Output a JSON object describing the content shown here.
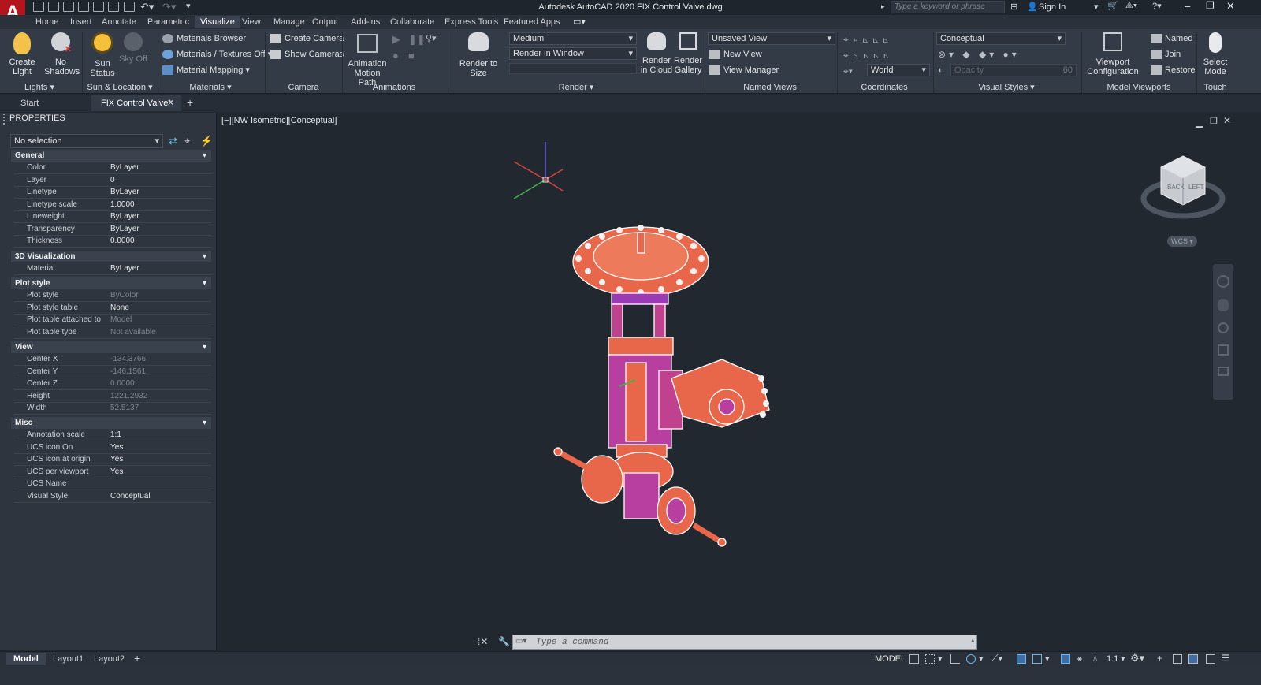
{
  "app": {
    "title": "Autodesk AutoCAD 2020   FIX Control Valve.dwg",
    "logo": "A",
    "search_placeholder": "Type a keyword or phrase",
    "signin": "Sign In"
  },
  "ribbon_tabs": [
    "Home",
    "Insert",
    "Annotate",
    "Parametric",
    "Visualize",
    "View",
    "Manage",
    "Output",
    "Add-ins",
    "Collaborate",
    "Express Tools",
    "Featured Apps"
  ],
  "active_tab": "Visualize",
  "panels": {
    "lights": {
      "title": "Lights",
      "create_light": "Create Light",
      "no_shadows": "No Shadows"
    },
    "sun": {
      "title": "Sun & Location",
      "sun_status": "Sun Status",
      "sky_off": "Sky Off"
    },
    "materials": {
      "title": "Materials",
      "browser": "Materials Browser",
      "textures": "Materials / Textures Off",
      "mapping": "Material Mapping"
    },
    "camera": {
      "title": "Camera",
      "create": "Create Camera",
      "show": "Show  Cameras"
    },
    "animations": {
      "title": "Animations",
      "motion_path": "Animation Motion Path"
    },
    "render": {
      "title": "Render",
      "render_to_size": "Render to Size",
      "quality": "Medium",
      "target": "Render in Window",
      "cloud": "Render in Cloud",
      "gallery": "Render Gallery"
    },
    "named_views": {
      "title": "Named Views",
      "current": "Unsaved View",
      "new_view": "New View",
      "manager": "View Manager"
    },
    "coordinates": {
      "title": "Coordinates",
      "ucs": "World"
    },
    "visual_styles": {
      "title": "Visual Styles",
      "style": "Conceptual",
      "opacity_label": "Opacity",
      "opacity_value": "60"
    },
    "model_viewports": {
      "title": "Model Viewports",
      "config": "Viewport Configuration",
      "named": "Named",
      "join": "Join",
      "restore": "Restore"
    },
    "touch": {
      "title": "Touch",
      "select_mode": "Select Mode"
    }
  },
  "doc_tabs": [
    "Start",
    "FIX Control Valve*"
  ],
  "properties": {
    "title": "PROPERTIES",
    "selection": "No selection",
    "sections": {
      "general": "General",
      "viz": "3D Visualization",
      "plot": "Plot style",
      "view": "View",
      "misc": "Misc"
    },
    "general": [
      [
        "Color",
        "ByLayer"
      ],
      [
        "Layer",
        "0"
      ],
      [
        "Linetype",
        "ByLayer"
      ],
      [
        "Linetype scale",
        "1.0000"
      ],
      [
        "Lineweight",
        "ByLayer"
      ],
      [
        "Transparency",
        "ByLayer"
      ],
      [
        "Thickness",
        "0.0000"
      ]
    ],
    "viz": [
      [
        "Material",
        "ByLayer"
      ]
    ],
    "plot": [
      [
        "Plot style",
        "ByColor"
      ],
      [
        "Plot style table",
        "None"
      ],
      [
        "Plot table attached to",
        "Model"
      ],
      [
        "Plot table type",
        "Not available"
      ]
    ],
    "view": [
      [
        "Center X",
        "-134.3766"
      ],
      [
        "Center Y",
        "-146.1561"
      ],
      [
        "Center Z",
        "0.0000"
      ],
      [
        "Height",
        "1221.2932"
      ],
      [
        "Width",
        "52.5137"
      ]
    ],
    "misc": [
      [
        "Annotation scale",
        "1:1"
      ],
      [
        "UCS icon On",
        "Yes"
      ],
      [
        "UCS icon at origin",
        "Yes"
      ],
      [
        "UCS per viewport",
        "Yes"
      ],
      [
        "UCS Name",
        ""
      ],
      [
        "Visual Style",
        "Conceptual"
      ]
    ]
  },
  "viewport": {
    "label": "[−][NW Isometric][Conceptual]",
    "wcs": "WCS",
    "cube_face1": "LEFT",
    "cube_face2": "BACK"
  },
  "command": {
    "placeholder": "Type  a  command"
  },
  "layout_tabs": [
    "Model",
    "Layout1",
    "Layout2"
  ],
  "status": {
    "model": "MODEL",
    "scale": "1:1"
  },
  "colors": {
    "accent": "#e8674a",
    "body": "#2e353f",
    "canvas": "#212830"
  }
}
